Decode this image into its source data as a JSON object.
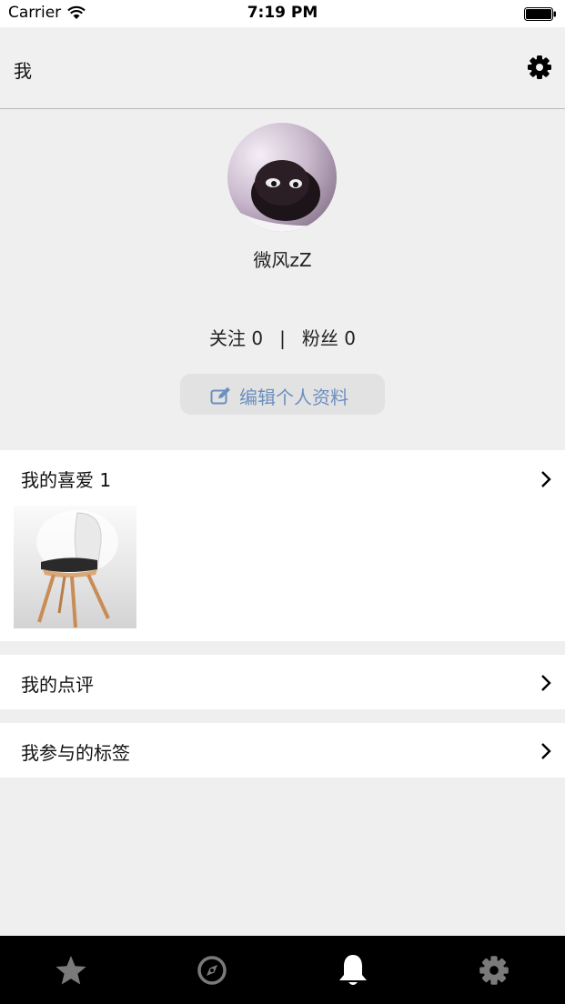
{
  "status_bar": {
    "carrier": "Carrier",
    "time": "7:19 PM"
  },
  "nav": {
    "title": "我",
    "settings_icon": "gear-icon"
  },
  "profile": {
    "username": "微风zZ",
    "following_label": "关注",
    "following_count": "0",
    "separator": "|",
    "followers_label": "粉丝",
    "followers_count": "0",
    "edit_button_label": "编辑个人资料"
  },
  "sections": {
    "favorites_title": "我的喜爱 1",
    "reviews_title": "我的点评",
    "tags_title": "我参与的标签"
  },
  "tab_bar": {
    "icons": [
      "star-icon",
      "compass-icon",
      "bell-icon",
      "gear-icon"
    ],
    "active_index": 2,
    "active_color": "#ffffff",
    "inactive_color": "#7a7a7a"
  },
  "colors": {
    "accent": "#6b8fbf",
    "background": "#efefef",
    "tab_bar": "#000000"
  }
}
